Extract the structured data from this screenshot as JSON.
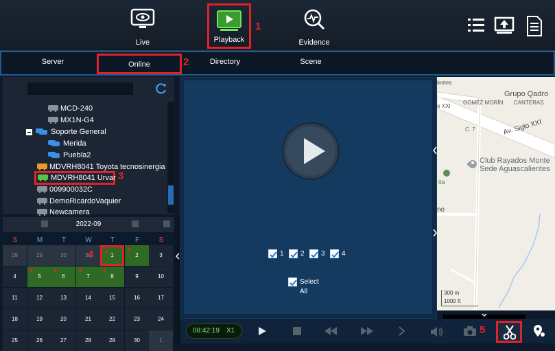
{
  "nav": {
    "live_label": "Live",
    "playback_label": "Playback",
    "evidence_label": "Evidence"
  },
  "tabs": {
    "server": "Server",
    "online": "Online",
    "directory": "Directory",
    "scene": "Scene"
  },
  "annotations": {
    "a1": "1",
    "a2": "2",
    "a3": "3",
    "a4": "4",
    "a5": "5"
  },
  "tree": [
    {
      "label": "MCD-240"
    },
    {
      "label": "MX1N-G4"
    },
    {
      "label": "Soporte General"
    },
    {
      "label": "Merida"
    },
    {
      "label": "Puebla2"
    },
    {
      "label": "MDVRH8041 Toyota tecnosinergia"
    },
    {
      "label": "MDVRH8041 Urvar"
    },
    {
      "label": "009900032C"
    },
    {
      "label": "DemoRicardoVaquier"
    },
    {
      "label": "Newcamera"
    }
  ],
  "calendar": {
    "month": "2022-09",
    "weekdays": [
      "S",
      "M",
      "T",
      "W",
      "T",
      "F",
      "S"
    ],
    "rows": [
      [
        "28",
        "29",
        "30",
        "31",
        "1",
        "2",
        "3"
      ],
      [
        "4",
        "5",
        "6",
        "7",
        "8",
        "9",
        "10"
      ],
      [
        "11",
        "12",
        "13",
        "14",
        "15",
        "16",
        "17"
      ],
      [
        "18",
        "19",
        "20",
        "21",
        "22",
        "23",
        "24"
      ],
      [
        "25",
        "26",
        "27",
        "28",
        "29",
        "30",
        "1"
      ]
    ]
  },
  "video": {
    "channels": [
      "1",
      "2",
      "3",
      "4"
    ],
    "select_all": "Select All"
  },
  "map": {
    "labels": {
      "ientes": "ientes",
      "grupo": "Grupo Qadro",
      "xxi_left": "o XXI",
      "gomez": "GÓMEZ MORÍN",
      "canteras": "CANTERAS",
      "c7": "C. 7",
      "siglo": "Av. Siglo XXI",
      "club": "Club Rayados Monte",
      "sede": "Sede Aguascalientes",
      "ita": "ita",
      "no": "no",
      "scale_m": "300 m",
      "scale_ft": "1000 ft"
    }
  },
  "playback": {
    "time": "08:42:19",
    "speed": "X1"
  }
}
